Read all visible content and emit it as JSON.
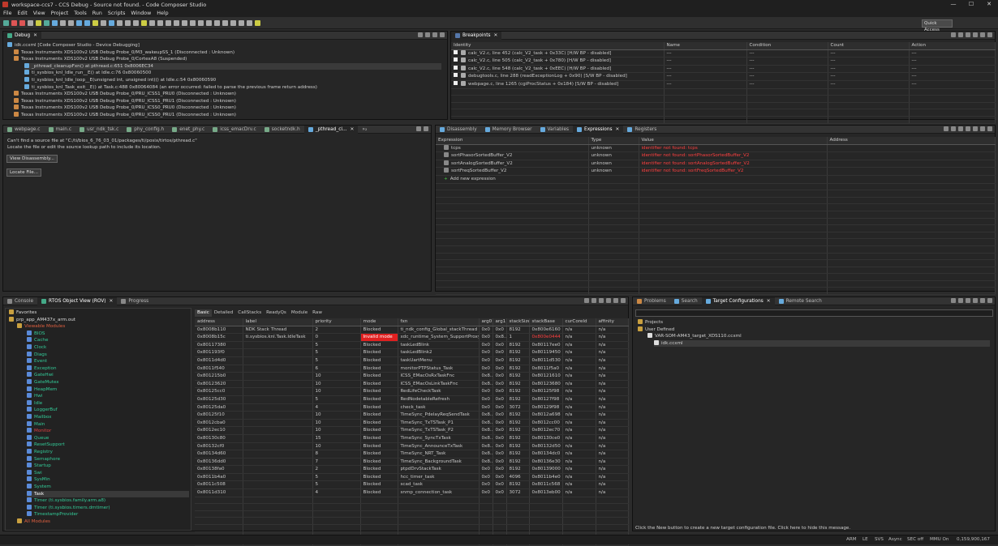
{
  "window": {
    "title": "workspace-ccs7 - CCS Debug - Source not found. - Code Composer Studio",
    "controls": [
      "—",
      "☐",
      "✕"
    ]
  },
  "menu": [
    "File",
    "Edit",
    "View",
    "Project",
    "Tools",
    "Run",
    "Scripts",
    "Window",
    "Help"
  ],
  "quick_access": "Quick Access",
  "debug": {
    "tab": "Debug",
    "items": [
      "idk.ccxml [Code Composer Studio - Device Debugging]",
      "Texas Instruments XDS100v2 USB Debug Probe_0/M3_wakeupSS_1 (Disconnected : Unknown)",
      "Texas Instruments XDS100v2 USB Debug Probe_0/CortexA8 (Suspended)",
      "_pthread_cleanupFxn() at pthread.c:651 0x8006EC34",
      "ti_sysbios_knl_Idle_run__E() at Idle.c:76 0x80060500",
      "ti_sysbios_knl_Idle_loop__E(unsigned int, unsigned int)() at Idle.c:54 0x80060590",
      "ti_sysbios_knl_Task_exit__E() at Task.c:488 0x80064084  (an error occurred: failed to parse the previous frame return address)",
      "Texas Instruments XDS100v2 USB Debug Probe_0/PRU_ICSS1_PRU0 (Disconnected : Unknown)",
      "Texas Instruments XDS100v2 USB Debug Probe_0/PRU_ICSS1_PRU1 (Disconnected : Unknown)",
      "Texas Instruments XDS100v2 USB Debug Probe_0/PRU_ICSS0_PRU0 (Disconnected : Unknown)",
      "Texas Instruments XDS100v2 USB Debug Probe_0/PRU_ICSS0_PRU1 (Disconnected : Unknown)"
    ]
  },
  "breakpoints": {
    "tab": "Breakpoints",
    "columns": [
      "Identity",
      "Name",
      "Condition",
      "Count",
      "Action"
    ],
    "rows": [
      [
        "calc_V2.c, line 452 (calc_V2_task + 0x33C)  [H/W BP - disabled]",
        "---",
        "---",
        "---",
        "---"
      ],
      [
        "calc_V2.c, line 505 (calc_V2_task + 0x780)  [H/W BP - disabled]",
        "---",
        "---",
        "---",
        "---"
      ],
      [
        "calc_V2.c, line 548 (calc_V2_task + 0xEEC)  [H/W BP - disabled]",
        "---",
        "---",
        "---",
        "---"
      ],
      [
        "debugtools.c, line 288 (readExceptionLog + 0x90)  [S/W BP - disabled]",
        "---",
        "---",
        "---",
        "---"
      ],
      [
        "webpage.c, line 1265 (cgiProcStatus + 0x184)  [S/W BP - disabled]",
        "---",
        "---",
        "---",
        "---"
      ]
    ]
  },
  "editor": {
    "tabs": [
      "webpage.c",
      "main.c",
      "usr_ndk_tsk.c",
      "phy_config.h",
      "enet_phy.c",
      "icss_emacDrv.c",
      "socketndk.h",
      "_pthread_cl..."
    ],
    "overflow": "»₂",
    "msg1": "Can't find a source file at \"C:/ti/bios_6_76_03_01/packages/ti/posix/tirtos/pthread.c\"",
    "msg2": "Locate the file or edit the source lookup path to include its location.",
    "btn_disasm": "View Disassembly...",
    "btn_locate": "Locate File..."
  },
  "expressions": {
    "tabs": [
      "Disassembly",
      "Memory Browser",
      "Variables",
      "Expressions",
      "Registers"
    ],
    "columns": [
      "Expression",
      "Type",
      "Value",
      "Address"
    ],
    "rows": [
      [
        "tcps",
        "unknown",
        "identifier not found: tcps"
      ],
      [
        "sortPhasorSortedBuffer_V2",
        "unknown",
        "identifier not found: sortPhasorSortedBuffer_V2"
      ],
      [
        "sortAnalogSortedBuffer_V2",
        "unknown",
        "identifier not found: sortAnalogSortedBuffer_V2"
      ],
      [
        "sortFreqSortedBuffer_V2",
        "unknown",
        "identifier not found: sortFreqSortedBuffer_V2"
      ]
    ],
    "add": "Add new expression"
  },
  "bottom_left": {
    "tabs": [
      "Console",
      "RTOS Object View (ROV)",
      "Progress"
    ],
    "tree": [
      {
        "t": "Favorites",
        "lvl": 1,
        "c": "#ddd"
      },
      {
        "t": "prp_app_AM437x_arm.out",
        "lvl": 1,
        "c": "#ddd"
      },
      {
        "t": "Viewable Modules",
        "lvl": 2,
        "c": "#e06040"
      },
      {
        "t": "BIOS",
        "lvl": 3,
        "c": "#3c9"
      },
      {
        "t": "Cache",
        "lvl": 3,
        "c": "#3c9"
      },
      {
        "t": "Clock",
        "lvl": 3,
        "c": "#3c9"
      },
      {
        "t": "Diags",
        "lvl": 3,
        "c": "#3c9"
      },
      {
        "t": "Event",
        "lvl": 3,
        "c": "#3c9"
      },
      {
        "t": "Exception",
        "lvl": 3,
        "c": "#3c9"
      },
      {
        "t": "GateHwi",
        "lvl": 3,
        "c": "#3c9"
      },
      {
        "t": "GateMutex",
        "lvl": 3,
        "c": "#3c9"
      },
      {
        "t": "HeapMem",
        "lvl": 3,
        "c": "#3c9"
      },
      {
        "t": "Hwi",
        "lvl": 3,
        "c": "#3c9"
      },
      {
        "t": "Idle",
        "lvl": 3,
        "c": "#3c9"
      },
      {
        "t": "LoggerBuf",
        "lvl": 3,
        "c": "#3c9"
      },
      {
        "t": "Mailbox",
        "lvl": 3,
        "c": "#3c9"
      },
      {
        "t": "Main",
        "lvl": 3,
        "c": "#3c9"
      },
      {
        "t": "Monitor",
        "lvl": 3,
        "c": "#e04040"
      },
      {
        "t": "Queue",
        "lvl": 3,
        "c": "#3c9"
      },
      {
        "t": "ResetSupport",
        "lvl": 3,
        "c": "#3c9"
      },
      {
        "t": "Registry",
        "lvl": 3,
        "c": "#3c9"
      },
      {
        "t": "Semaphore",
        "lvl": 3,
        "c": "#3c9"
      },
      {
        "t": "Startup",
        "lvl": 3,
        "c": "#3c9"
      },
      {
        "t": "Swi",
        "lvl": 3,
        "c": "#3c9"
      },
      {
        "t": "SysMin",
        "lvl": 3,
        "c": "#3c9"
      },
      {
        "t": "System",
        "lvl": 3,
        "c": "#3c9"
      },
      {
        "t": "Task",
        "lvl": 3,
        "c": "#fff",
        "sel": true
      },
      {
        "t": "Timer (ti.sysbios.family.arm.a8)",
        "lvl": 3,
        "c": "#3c9"
      },
      {
        "t": "Timer (ti.sysbios.timers.dmtimer)",
        "lvl": 3,
        "c": "#3c9"
      },
      {
        "t": "TimestampProvider",
        "lvl": 3,
        "c": "#3c9"
      },
      {
        "t": "All Modules",
        "lvl": 2,
        "c": "#e06040"
      }
    ],
    "view_tabs": [
      "Basic",
      "Detailed",
      "CallStacks",
      "ReadyQs",
      "Module",
      "Raw"
    ],
    "columns": [
      "address",
      "label",
      "priority",
      "mode",
      "fxn",
      "arg0",
      "arg1",
      "stackSize",
      "stackBase",
      "curCoreId",
      "affinity"
    ],
    "rows": [
      [
        "0x8008b110",
        "NDK Stack Thread",
        "2",
        "Blocked",
        "ti_ndk_config_Global_stackThread",
        "0x0",
        "0x0",
        "8192",
        "0x800e6160",
        "n/a",
        "n/a"
      ],
      [
        "0x8008b15c",
        "ti.sysbios.knl.Task.IdleTask",
        "0",
        "Invalid mode",
        "xdc_runtime_System_SupportProxy_...",
        "0x0",
        "0x8...",
        "1",
        "0x800e0444",
        "n/a",
        "n/a"
      ],
      [
        "0x80117380",
        "",
        "5",
        "Blocked",
        "taskLedBlink",
        "0x0",
        "0x0",
        "8192",
        "0x80117ee0",
        "n/a",
        "n/a"
      ],
      [
        "0x801193f0",
        "",
        "5",
        "Blocked",
        "taskLedBlink2",
        "0x0",
        "0x0",
        "8192",
        "0x80119450",
        "n/a",
        "n/a"
      ],
      [
        "0x8011d4d0",
        "",
        "5",
        "Blocked",
        "taskUartMenu",
        "0x0",
        "0x0",
        "8192",
        "0x8011d530",
        "n/a",
        "n/a"
      ],
      [
        "0x8011f540",
        "",
        "6",
        "Blocked",
        "monitorPTPStatus_Task",
        "0x0",
        "0x0",
        "8192",
        "0x8011f5a0",
        "n/a",
        "n/a"
      ],
      [
        "0x801215b0",
        "",
        "10",
        "Blocked",
        "ICSS_EMacOsRxTaskFnc",
        "0x8...",
        "0x0",
        "8192",
        "0x80121610",
        "n/a",
        "n/a"
      ],
      [
        "0x80123620",
        "",
        "10",
        "Blocked",
        "ICSS_EMacOsLinkTaskFnc",
        "0x8...",
        "0x0",
        "8192",
        "0x80123680",
        "n/a",
        "n/a"
      ],
      [
        "0x80125cc0",
        "",
        "10",
        "Blocked",
        "RedLifeCheckTask",
        "0x0",
        "0x0",
        "8192",
        "0x80125f98",
        "n/a",
        "n/a"
      ],
      [
        "0x80125d30",
        "",
        "5",
        "Blocked",
        "RedNodetableRefresh",
        "0x0",
        "0x0",
        "8192",
        "0x80127f98",
        "n/a",
        "n/a"
      ],
      [
        "0x80125da0",
        "",
        "4",
        "Blocked",
        "check_task",
        "0x0",
        "0x0",
        "3072",
        "0x80129f98",
        "n/a",
        "n/a"
      ],
      [
        "0x80125f10",
        "",
        "10",
        "Blocked",
        "TimeSync_PdelayReqSendTask",
        "0x8...",
        "0x0",
        "8192",
        "0x8012a698",
        "n/a",
        "n/a"
      ],
      [
        "0x8012cba0",
        "",
        "10",
        "Blocked",
        "TimeSync_TxTSTask_P1",
        "0x8...",
        "0x0",
        "8192",
        "0x8012cc00",
        "n/a",
        "n/a"
      ],
      [
        "0x8012ec10",
        "",
        "10",
        "Blocked",
        "TimeSync_TxTSTask_P2",
        "0x8...",
        "0x0",
        "8192",
        "0x8012ec70",
        "n/a",
        "n/a"
      ],
      [
        "0x80130c80",
        "",
        "15",
        "Blocked",
        "TimeSync_SyncTxTask",
        "0x8...",
        "0x0",
        "8192",
        "0x80130ce0",
        "n/a",
        "n/a"
      ],
      [
        "0x80132cf0",
        "",
        "10",
        "Blocked",
        "TimeSync_AnnounceTxTask",
        "0x8...",
        "0x0",
        "8192",
        "0x80132d50",
        "n/a",
        "n/a"
      ],
      [
        "0x80134d60",
        "",
        "8",
        "Blocked",
        "TimeSync_NRT_Task",
        "0x8...",
        "0x0",
        "8192",
        "0x80134dc0",
        "n/a",
        "n/a"
      ],
      [
        "0x80136dd0",
        "",
        "7",
        "Blocked",
        "TimeSync_BackgroundTask",
        "0x8...",
        "0x0",
        "8192",
        "0x80136e30",
        "n/a",
        "n/a"
      ],
      [
        "0x80138fa0",
        "",
        "2",
        "Blocked",
        "ptpdDrvStackTask",
        "0x0",
        "0x0",
        "8192",
        "0x80139000",
        "n/a",
        "n/a"
      ],
      [
        "0x8011b4a0",
        "",
        "5",
        "Blocked",
        "hcc_timer_task",
        "0x0",
        "0x0",
        "4096",
        "0x8011b4e0",
        "n/a",
        "n/a"
      ],
      [
        "0x8011c508",
        "",
        "5",
        "Blocked",
        "scad_task",
        "0x0",
        "0x0",
        "8192",
        "0x8011c568",
        "n/a",
        "n/a"
      ],
      [
        "0x8011d310",
        "",
        "4",
        "Blocked",
        "snmp_connection_task",
        "0x0",
        "0x0",
        "3072",
        "0x8013eb00",
        "n/a",
        "n/a"
      ]
    ]
  },
  "bottom_right": {
    "tabs": [
      "Problems",
      "Search",
      "Target Configurations",
      "Remote Search"
    ],
    "tree": [
      "Projects",
      "User Defined",
      "VAR-SOM-AM43_target_XDS110.ccxml",
      "idk.ccxml"
    ],
    "hint": "Click the New button to create a new target configuration file. Click here to hide this message."
  },
  "status": [
    "ARM",
    "LE",
    "SVS",
    "Async",
    "SEC off",
    "MMU On",
    "0,159,900,167"
  ],
  "colors": {
    "accent": "#3c9",
    "error": "#e02020"
  }
}
